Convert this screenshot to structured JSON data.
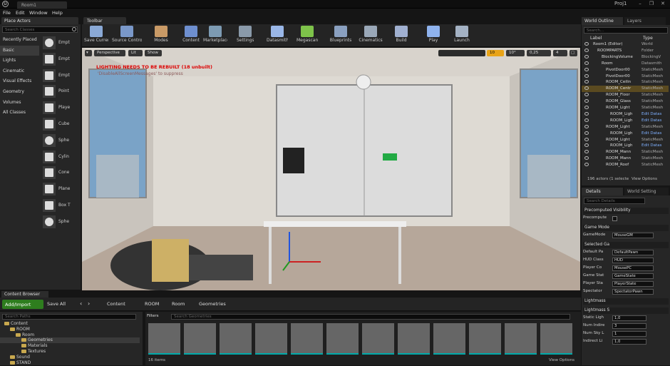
{
  "window": {
    "doc_tab": "Room1",
    "project": "Proj1",
    "minimize": "–",
    "maximize": "❐",
    "close": "✕"
  },
  "menu": [
    "File",
    "Edit",
    "Window",
    "Help"
  ],
  "place_actors": {
    "tab": "Place Actors",
    "search_placeholder": "Search Classes",
    "categories": [
      "Recently Placed",
      "Basic",
      "Lights",
      "Cinematic",
      "Visual Effects",
      "Geometry",
      "Volumes",
      "All Classes"
    ],
    "selected_category": "Basic",
    "items": [
      "Empt",
      "Empt",
      "Empt",
      "Point",
      "Playe",
      "Cube",
      "Sphe",
      "Cylin",
      "Cone",
      "Plane",
      "Box T",
      "Sphe"
    ]
  },
  "toolbar": {
    "tab": "Toolbar",
    "buttons": [
      "Save Current",
      "Source Control",
      "Modes",
      "Content",
      "Marketplace",
      "Settings",
      "Datasmith",
      "Megascans",
      "Blueprints",
      "Cinematics",
      "Build",
      "Play",
      "Launch"
    ]
  },
  "viewport": {
    "perspective": "Perspective",
    "lit": "Lit",
    "show": "Show",
    "warning": "LIGHTING NEEDS TO BE REBUILT (18 unbuilt)",
    "warning_sub": "'DisableAllScreenMessages' to suppress",
    "grid_snap": "10",
    "rot_snap": "10°",
    "scale_snap": "0,25",
    "cam_speed": "4"
  },
  "outliner": {
    "tabs": [
      "World Outline",
      "Layers"
    ],
    "search_placeholder": "Search...",
    "col_label": "Label",
    "col_type": "Type",
    "rows": [
      {
        "label": "Room1 (Editor)",
        "type": "World"
      },
      {
        "label": "ROOMPARTS",
        "type": "Folder"
      },
      {
        "label": "BlockingVolume",
        "type": "BlockingV"
      },
      {
        "label": "Room",
        "type": "Datasmith"
      },
      {
        "label": "PivotDoor00",
        "type": "StaticMesh"
      },
      {
        "label": "PivotDoor00",
        "type": "StaticMesh"
      },
      {
        "label": "ROOM_Ceilin",
        "type": "StaticMesh"
      },
      {
        "label": "ROOM_Centr",
        "type": "StaticMesh"
      },
      {
        "label": "ROOM_Floor",
        "type": "StaticMesh"
      },
      {
        "label": "ROOM_Glass",
        "type": "StaticMesh"
      },
      {
        "label": "ROOM_Light",
        "type": "StaticMesh"
      },
      {
        "label": "ROOM_Ligh",
        "type": "Edit Datas"
      },
      {
        "label": "ROOM_Ligh",
        "type": "Edit Datas"
      },
      {
        "label": "ROOM_Light",
        "type": "StaticMesh"
      },
      {
        "label": "ROOM_Ligh",
        "type": "Edit Datas"
      },
      {
        "label": "ROOM_Light",
        "type": "StaticMesh"
      },
      {
        "label": "ROOM_Ligh",
        "type": "Edit Datas"
      },
      {
        "label": "ROOM_Mann",
        "type": "StaticMesh"
      },
      {
        "label": "ROOM_Mann",
        "type": "StaticMesh"
      },
      {
        "label": "ROOM_Roof",
        "type": "StaticMesh"
      }
    ],
    "selected_index": 7,
    "status": "196 actors (1 selecte",
    "view_options": "View Options"
  },
  "details": {
    "tabs": [
      "Details",
      "World Setting"
    ],
    "search_placeholder": "Search Details",
    "sections": [
      {
        "title": "Precomputed Visibility",
        "props": [
          {
            "label": "Precompute",
            "value": ""
          }
        ]
      },
      {
        "title": "Game Mode",
        "props": [
          {
            "label": "GameMode",
            "value": "MouseGM"
          }
        ]
      },
      {
        "title": "Selected Ga",
        "props": [
          {
            "label": "Default Pa",
            "value": "DefaultPawn"
          },
          {
            "label": "HUD Class",
            "value": "HUD"
          },
          {
            "label": "Player Co",
            "value": "MousePC"
          },
          {
            "label": "Game Stat",
            "value": "GameState"
          },
          {
            "label": "Player Sta",
            "value": "PlayerState"
          },
          {
            "label": "Spectator",
            "value": "SpectatorPawn"
          }
        ]
      },
      {
        "title": "Lightmass",
        "props": []
      },
      {
        "title": "Lightmass S",
        "props": [
          {
            "label": "Static Ligh",
            "value": "1,0"
          },
          {
            "label": "Num Indire",
            "value": "3"
          },
          {
            "label": "Num Sky L",
            "value": "1"
          },
          {
            "label": "Indirect Li",
            "value": "1,0"
          }
        ]
      }
    ]
  },
  "content_browser": {
    "tab": "Content Browser",
    "add_import": "Add/Import",
    "save_all": "Save All",
    "path": [
      "Content",
      "ROOM",
      "Room",
      "Geometries"
    ],
    "search_paths": "Search Paths",
    "filters": "Filters",
    "search_placeholder": "Search Geometries",
    "tree": [
      {
        "label": "Content",
        "depth": 0
      },
      {
        "label": "ROOM",
        "depth": 1
      },
      {
        "label": "Room",
        "depth": 2
      },
      {
        "label": "Geometries",
        "depth": 3
      },
      {
        "label": "Materials",
        "depth": 3
      },
      {
        "label": "Textures",
        "depth": 3
      },
      {
        "label": "Sound",
        "depth": 1
      },
      {
        "label": "STAND",
        "depth": 1
      }
    ],
    "item_count": "16 items",
    "view_options": "View Options"
  },
  "colors": {
    "accent": "#e8a317",
    "selection": "#5a4a20",
    "warning": "#dd0000",
    "add_button": "#2e7d1e"
  }
}
